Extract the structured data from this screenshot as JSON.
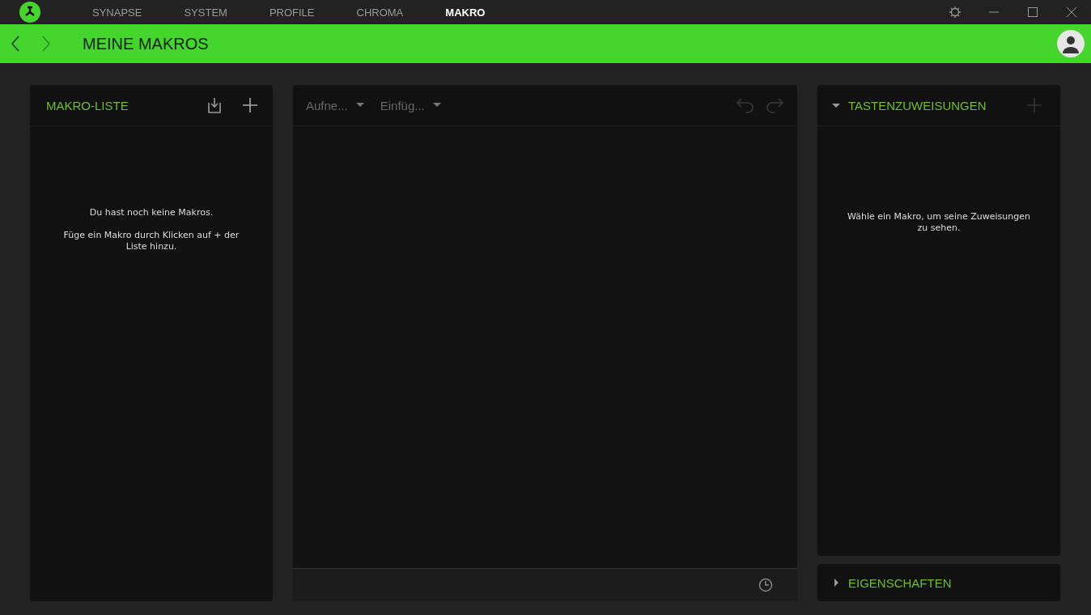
{
  "tabs": [
    {
      "label": "SYNAPSE",
      "selected": false
    },
    {
      "label": "SYSTEM",
      "selected": false
    },
    {
      "label": "PROFILE",
      "selected": false
    },
    {
      "label": "CHROMA",
      "selected": false
    },
    {
      "label": "MAKRO",
      "selected": true
    }
  ],
  "page_title": "MEINE MAKROS",
  "macro_list": {
    "title": "MAKRO-LISTE",
    "empty_messages": [
      "Du hast noch keine Makros.",
      "Füge ein Makro durch Klicken auf + der Liste hinzu."
    ]
  },
  "editor": {
    "dropdowns": [
      {
        "label": "Aufne...",
        "disabled": true
      },
      {
        "label": "Einfüg...",
        "disabled": true
      }
    ],
    "undo_disabled": true,
    "redo_disabled": true
  },
  "sections": [
    {
      "title": "TASTENZUWEISUNGEN",
      "expanded": true,
      "message": "Wähle ein Makro, um seine Zuweisungen zu sehen.",
      "add_disabled": true
    },
    {
      "title": "EIGENSCHAFTEN",
      "expanded": false
    }
  ]
}
